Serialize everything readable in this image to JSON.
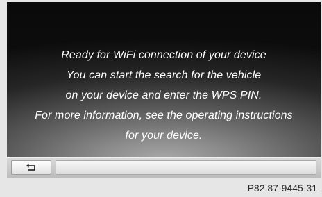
{
  "message": {
    "lines": [
      "Ready for WiFi connection of your device",
      "You can start the search for the vehicle",
      "on your device and enter the WPS PIN.",
      "For more information, see the operating instructions",
      "for your device."
    ]
  },
  "bottom_bar": {
    "back_icon": "back-arrow-icon"
  },
  "figure_code": "P82.87-9445-31",
  "colors": {
    "text": "#ffffff",
    "screen_dark": "#0d0d0d",
    "bar": "#cfcfcf"
  }
}
